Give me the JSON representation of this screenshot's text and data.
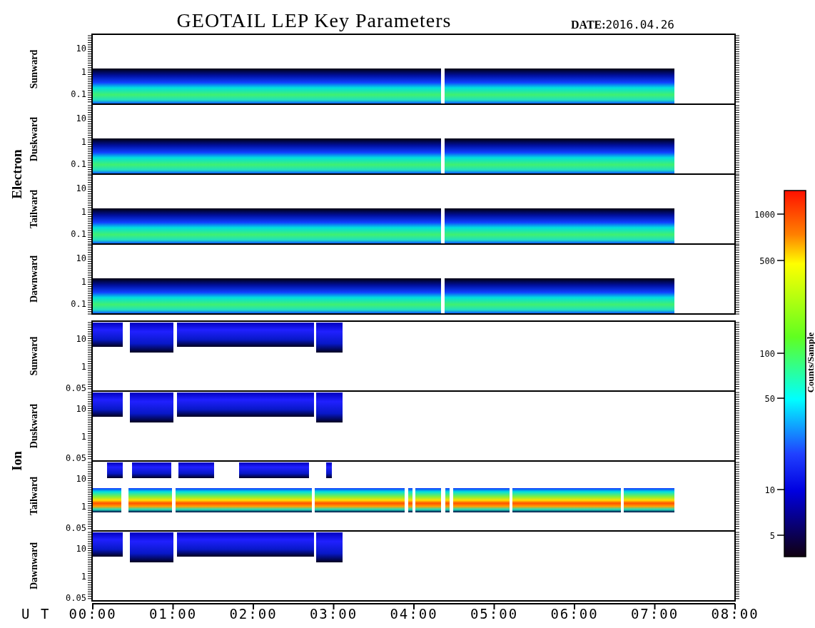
{
  "title": "GEOTAIL LEP Key Parameters",
  "date_label": "DATE:",
  "date": "2016.04.26",
  "groups": [
    {
      "name": "Electron",
      "panels": [
        {
          "label": "Sunward",
          "kind": "band",
          "yticks": [
            "10",
            "1",
            "0.1"
          ]
        },
        {
          "label": "Duskward",
          "kind": "band",
          "yticks": [
            "10",
            "1",
            "0.1"
          ]
        },
        {
          "label": "Tailward",
          "kind": "band",
          "yticks": [
            "10",
            "1",
            "0.1"
          ]
        },
        {
          "label": "Dawnward",
          "kind": "band",
          "yticks": [
            "10",
            "1",
            "0.1"
          ]
        }
      ]
    },
    {
      "name": "Ion",
      "panels": [
        {
          "label": "Sunward",
          "kind": "patchy",
          "yticks": [
            "10",
            "1",
            "0.05"
          ]
        },
        {
          "label": "Duskward",
          "kind": "patchy",
          "yticks": [
            "10",
            "1",
            "0.05"
          ]
        },
        {
          "label": "Tailward",
          "kind": "patchy_band",
          "yticks": [
            "10",
            "1",
            "0.05"
          ]
        },
        {
          "label": "Dawnward",
          "kind": "patchy",
          "yticks": [
            "10",
            "1",
            "0.05"
          ]
        }
      ]
    }
  ],
  "time_axis": {
    "label": "U T",
    "ticks": [
      "00:00",
      "01:00",
      "02:00",
      "03:00",
      "04:00",
      "05:00",
      "06:00",
      "07:00",
      "08:00"
    ]
  },
  "colorbar": {
    "label": "Counts/Sample",
    "ticks": [
      "1000",
      "500",
      "100",
      "50",
      "10",
      "5"
    ]
  }
}
